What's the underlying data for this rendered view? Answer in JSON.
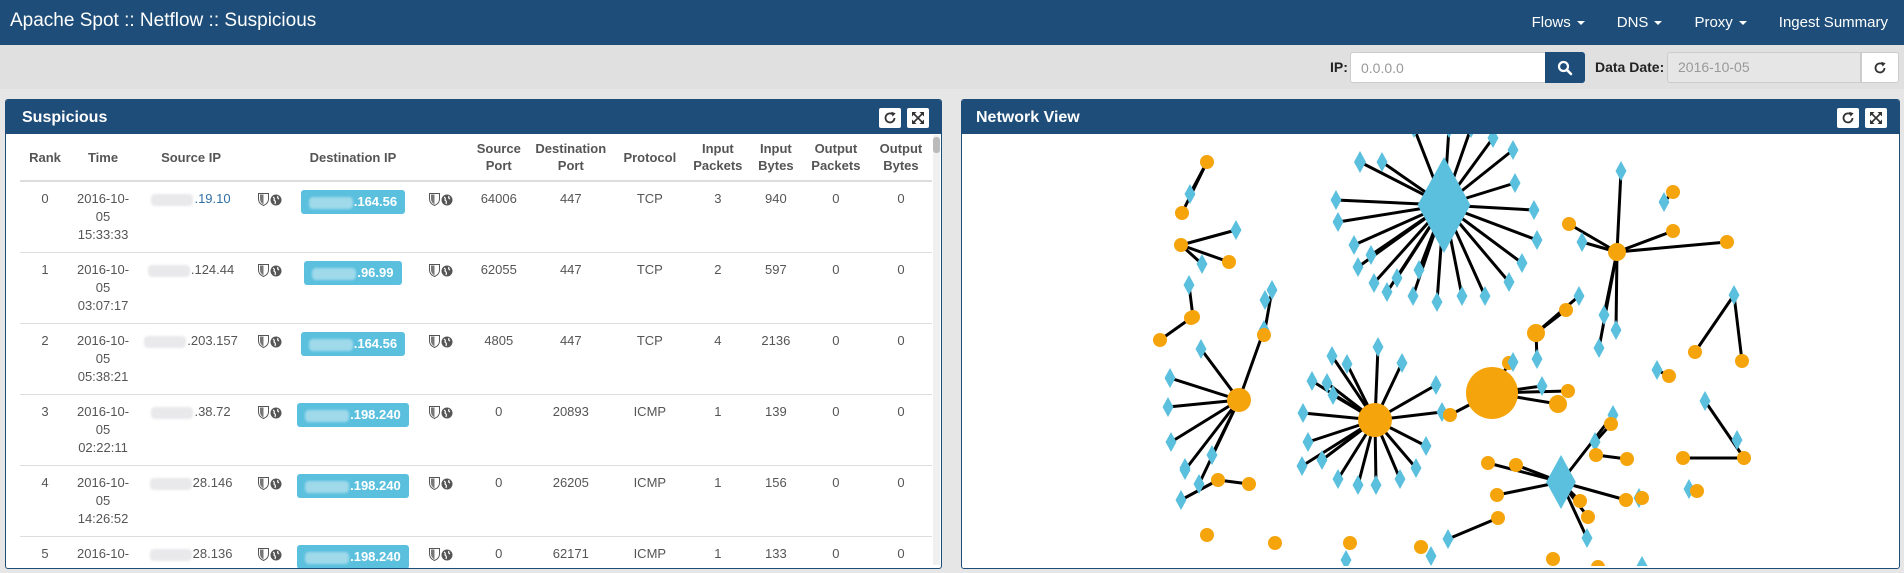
{
  "navbar": {
    "title": "Apache Spot :: Netflow :: Suspicious",
    "items": [
      {
        "label": "Flows",
        "has_caret": true
      },
      {
        "label": "DNS",
        "has_caret": true
      },
      {
        "label": "Proxy",
        "has_caret": true
      },
      {
        "label": "Ingest Summary",
        "has_caret": false
      }
    ]
  },
  "filters": {
    "ip_label": "IP:",
    "ip_placeholder": "0.0.0.0",
    "ip_value": "",
    "date_label": "Data Date:",
    "date_value": "2016-10-05",
    "search_icon": "search-icon",
    "reload_icon": "refresh-icon"
  },
  "suspicious_panel": {
    "title": "Suspicious",
    "columns": [
      "Rank",
      "Time",
      "Source IP",
      "Destination IP",
      "Source Port",
      "Destination Port",
      "Protocol",
      "Input Packets",
      "Input Bytes",
      "Output Packets",
      "Output Bytes"
    ],
    "rows": [
      {
        "rank": "0",
        "time": "2016-10-05 15:33:33",
        "src_ip": ".19.10",
        "src_link": true,
        "dst_ip": ".164.56",
        "src_port": "64006",
        "dst_port": "447",
        "protocol": "TCP",
        "in_pkts": "3",
        "in_bytes": "940",
        "out_pkts": "0",
        "out_bytes": "0"
      },
      {
        "rank": "1",
        "time": "2016-10-05 03:07:17",
        "src_ip": ".124.44",
        "src_link": false,
        "dst_ip": ".96.99",
        "src_port": "62055",
        "dst_port": "447",
        "protocol": "TCP",
        "in_pkts": "2",
        "in_bytes": "597",
        "out_pkts": "0",
        "out_bytes": "0"
      },
      {
        "rank": "2",
        "time": "2016-10-05 05:38:21",
        "src_ip": ".203.157",
        "src_link": false,
        "dst_ip": ".164.56",
        "src_port": "4805",
        "dst_port": "447",
        "protocol": "TCP",
        "in_pkts": "4",
        "in_bytes": "2136",
        "out_pkts": "0",
        "out_bytes": "0"
      },
      {
        "rank": "3",
        "time": "2016-10-05 02:22:11",
        "src_ip": ".38.72",
        "src_link": false,
        "dst_ip": ".198.240",
        "src_port": "0",
        "dst_port": "20893",
        "protocol": "ICMP",
        "in_pkts": "1",
        "in_bytes": "139",
        "out_pkts": "0",
        "out_bytes": "0"
      },
      {
        "rank": "4",
        "time": "2016-10-05 14:26:52",
        "src_ip": "28.146",
        "src_link": false,
        "dst_ip": ".198.240",
        "src_port": "0",
        "dst_port": "26205",
        "protocol": "ICMP",
        "in_pkts": "1",
        "in_bytes": "156",
        "out_pkts": "0",
        "out_bytes": "0"
      },
      {
        "rank": "5",
        "time": "2016-10-",
        "src_ip": "28.136",
        "src_link": false,
        "dst_ip": ".198.240",
        "src_port": "0",
        "dst_port": "62171",
        "protocol": "ICMP",
        "in_pkts": "1",
        "in_bytes": "133",
        "out_pkts": "0",
        "out_bytes": "0"
      }
    ]
  },
  "network_panel": {
    "title": "Network View"
  },
  "colors": {
    "brand": "#1d4d78",
    "node_blue": "#5bc0de",
    "node_orange": "#f5a40c",
    "edge": "#000000"
  }
}
